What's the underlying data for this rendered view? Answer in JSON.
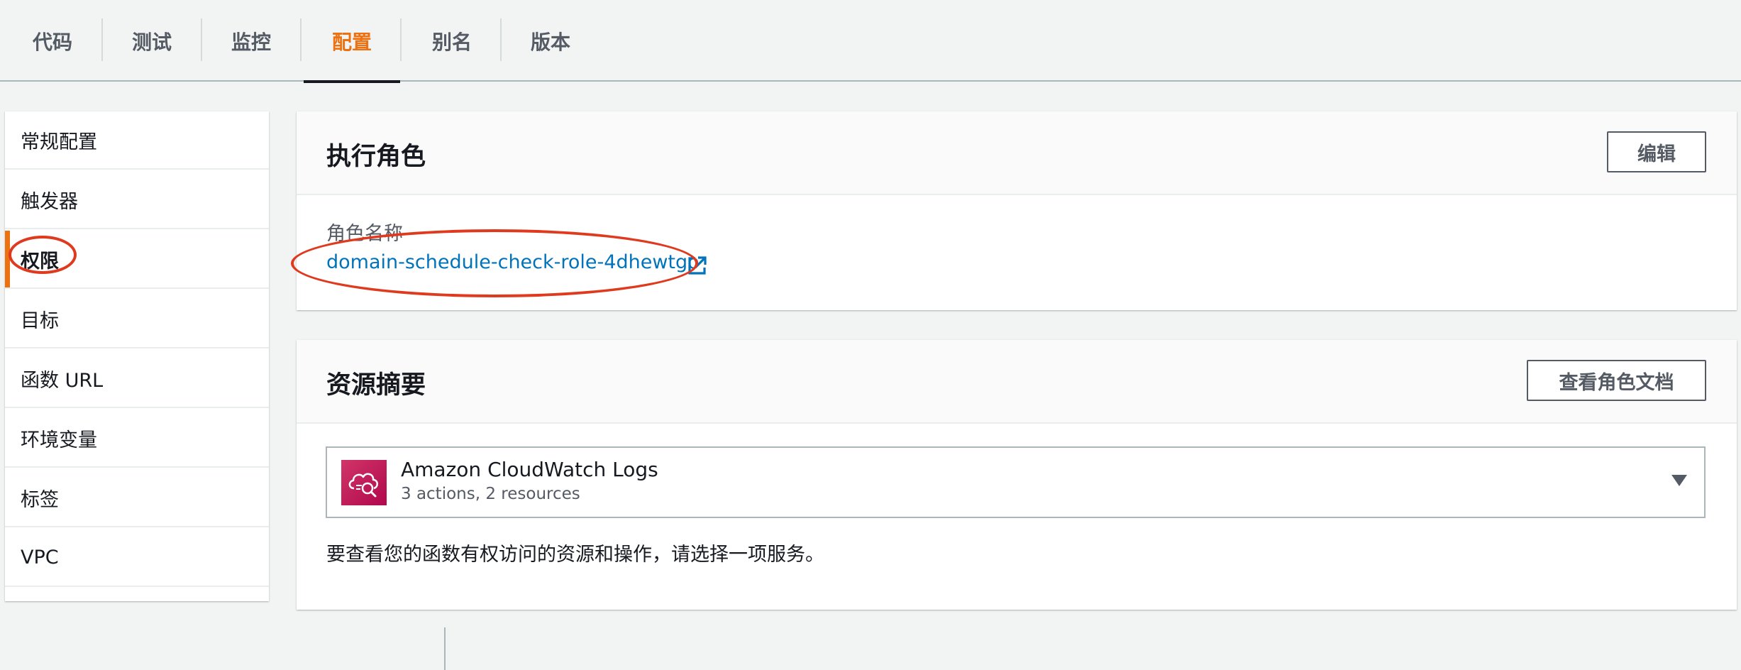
{
  "tabs": [
    {
      "label": "代码"
    },
    {
      "label": "测试"
    },
    {
      "label": "监控"
    },
    {
      "label": "配置",
      "active": true
    },
    {
      "label": "别名"
    },
    {
      "label": "版本"
    }
  ],
  "sidenav": {
    "items": [
      {
        "label": "常规配置"
      },
      {
        "label": "触发器"
      },
      {
        "label": "权限",
        "active": true
      },
      {
        "label": "目标"
      },
      {
        "label": "函数 URL"
      },
      {
        "label": "环境变量"
      },
      {
        "label": "标签"
      },
      {
        "label": "VPC"
      }
    ]
  },
  "execution_role": {
    "title": "执行角色",
    "edit_label": "编辑",
    "field_label": "角色名称",
    "role_name": "domain-schedule-check-role-4dhewtgo",
    "link_icon": "external-link-icon"
  },
  "resource_summary": {
    "title": "资源摘要",
    "view_docs_label": "查看角色文档",
    "service": {
      "name": "Amazon CloudWatch Logs",
      "meta": "3 actions, 2 resources",
      "icon": "cloudwatch-logs-icon"
    },
    "hint": "要查看您的函数有权访问的资源和操作，请选择一项服务。"
  },
  "colors": {
    "accent": "#ec7211",
    "link": "#0073bb",
    "annotation": "#e03a1e"
  }
}
